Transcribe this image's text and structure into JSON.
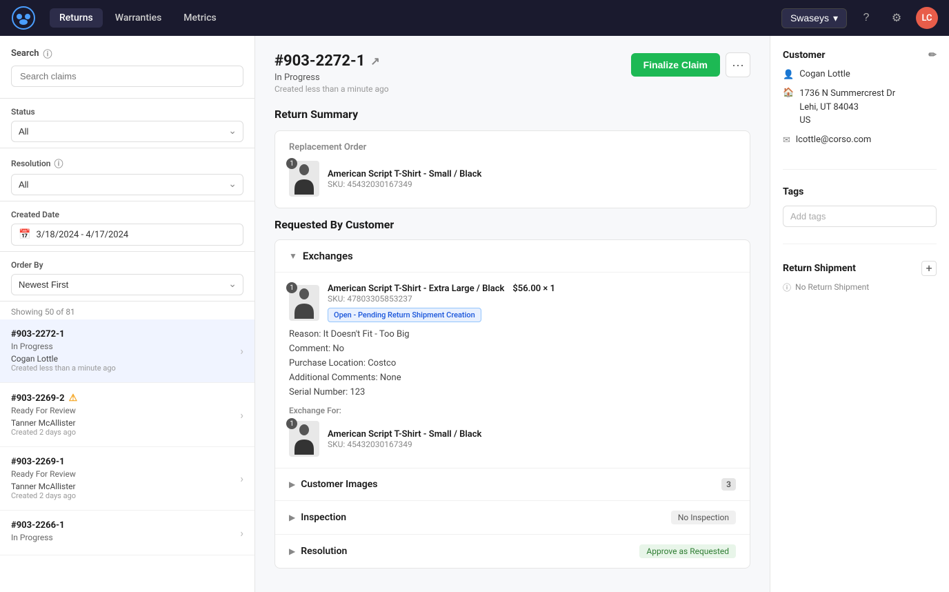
{
  "navbar": {
    "logo_text": "●",
    "nav_items": [
      {
        "label": "Returns",
        "active": true
      },
      {
        "label": "Warranties",
        "active": false
      },
      {
        "label": "Metrics",
        "active": false
      }
    ],
    "tenant_label": "Swaseys",
    "avatar_label": "LC"
  },
  "sidebar": {
    "search_label": "Search",
    "search_placeholder": "Search claims",
    "status_label": "Status",
    "status_value": "All",
    "resolution_label": "Resolution",
    "resolution_value": "All",
    "created_date_label": "Created Date",
    "date_range": "3/18/2024 - 4/17/2024",
    "order_by_label": "Order By",
    "order_by_value": "Newest First",
    "showing_text": "Showing 50 of 81",
    "claims": [
      {
        "id": "#903-2272-1",
        "status": "In Progress",
        "customer": "Cogan Lottle",
        "date": "Created less than a minute ago",
        "active": true,
        "warning": false
      },
      {
        "id": "#903-2269-2",
        "status": "Ready For Review",
        "customer": "Tanner McAllister",
        "date": "Created 2 days ago",
        "active": false,
        "warning": true
      },
      {
        "id": "#903-2269-1",
        "status": "Ready For Review",
        "customer": "Tanner McAllister",
        "date": "Created 2 days ago",
        "active": false,
        "warning": false
      },
      {
        "id": "#903-2266-1",
        "status": "In Progress",
        "customer": "",
        "date": "",
        "active": false,
        "warning": false
      }
    ]
  },
  "claim_detail": {
    "id": "#903-2272-1",
    "status": "In Progress",
    "created": "Created less than a minute ago",
    "finalize_label": "Finalize Claim",
    "return_summary_title": "Return Summary",
    "replacement_order_label": "Replacement Order",
    "replacement_product": {
      "qty": 1,
      "name": "American Script T-Shirt - Small / Black",
      "sku": "SKU: 45432030167349"
    },
    "requested_by_title": "Requested By Customer",
    "exchanges_label": "Exchanges",
    "exchange_product": {
      "qty": 1,
      "name": "American Script T-Shirt - Extra Large / Black",
      "sku": "SKU: 47803305853237",
      "price": "$56.00 × 1",
      "badge": "Open - Pending Return Shipment Creation"
    },
    "reason": "Reason: It Doesn't Fit - Too Big",
    "comment": "Comment: No",
    "purchase_location": "Purchase Location: Costco",
    "additional_comments": "Additional Comments: None",
    "serial_number": "Serial Number: 123",
    "exchange_for_label": "Exchange For:",
    "exchange_for_product": {
      "qty": 1,
      "name": "American Script T-Shirt - Small / Black",
      "sku": "SKU: 45432030167349"
    },
    "customer_images_label": "Customer Images",
    "customer_images_count": "3",
    "inspection_label": "Inspection",
    "inspection_status": "No Inspection",
    "resolution_label": "Resolution",
    "resolution_status": "Approve as Requested"
  },
  "right_panel": {
    "customer_title": "Customer",
    "customer_name": "Cogan Lottle",
    "customer_address_line1": "1736 N Summercrest Dr",
    "customer_address_line2": "Lehi, UT 84043",
    "customer_address_line3": "US",
    "customer_email": "lcottle@corso.com",
    "tags_title": "Tags",
    "tags_placeholder": "Add tags",
    "return_shipment_title": "Return Shipment",
    "no_return_shipment": "No Return Shipment"
  }
}
